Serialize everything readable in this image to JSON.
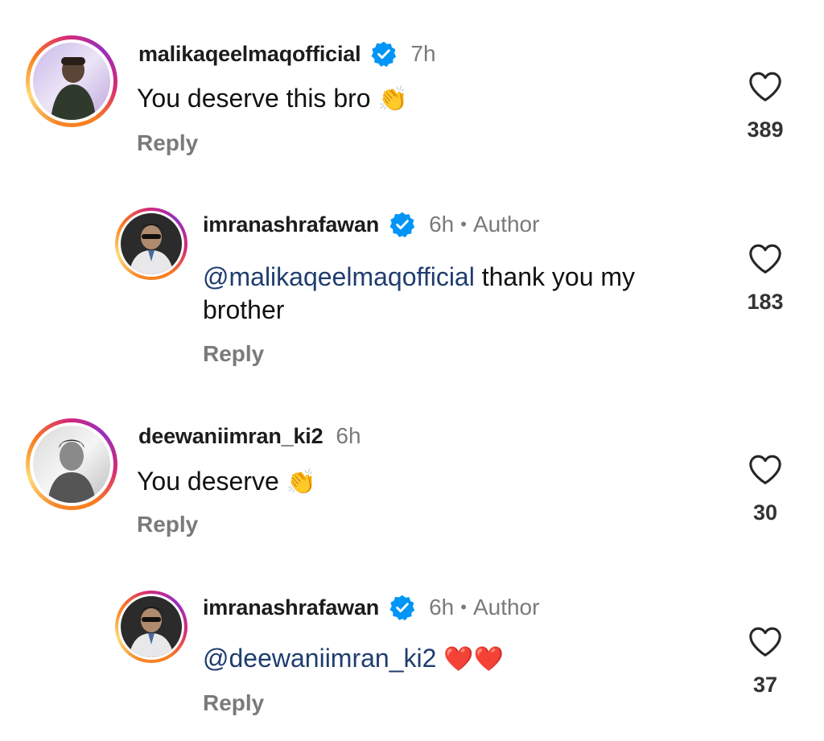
{
  "comments": [
    {
      "username": "malikaqeelmaqofficial",
      "verified": true,
      "time": "7h",
      "text": "You deserve this bro",
      "emoji": "👏",
      "reply_label": "Reply",
      "likes": "389"
    },
    {
      "username": "imranashrafawan",
      "verified": true,
      "time": "6h",
      "author_label": "Author",
      "mention": "@malikaqeelmaqofficial",
      "text": " thank you my brother",
      "reply_label": "Reply",
      "likes": "183"
    },
    {
      "username": "deewaniimran_ki2",
      "verified": false,
      "time": "6h",
      "text": "You deserve",
      "emoji": "👏",
      "reply_label": "Reply",
      "likes": "30"
    },
    {
      "username": "imranashrafawan",
      "verified": true,
      "time": "6h",
      "author_label": "Author",
      "mention": "@deewaniimran_ki2",
      "emoji": "❤️❤️",
      "reply_label": "Reply",
      "likes": "37"
    }
  ],
  "colors": {
    "verified_blue": "#0095f6",
    "mention": "#1f3d6e",
    "muted": "#7a7a7a"
  },
  "icons": {
    "like": "heart-outline-icon",
    "verified": "verified-badge-icon"
  }
}
